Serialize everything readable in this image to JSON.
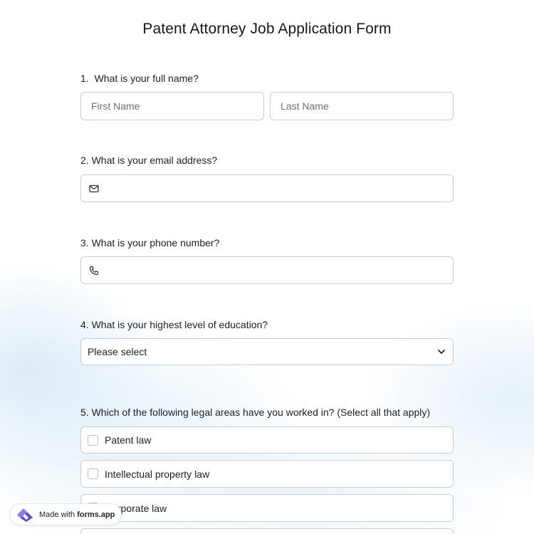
{
  "form": {
    "title": "Patent Attorney Job Application Form"
  },
  "questions": {
    "q1": {
      "number": "1.",
      "text": "What is your full name?",
      "first_placeholder": "First Name",
      "last_placeholder": "Last Name"
    },
    "q2": {
      "number": "2.",
      "text": "What is your email address?",
      "icon": "envelope-icon"
    },
    "q3": {
      "number": "3.",
      "text": "What is your phone number?",
      "icon": "phone-icon"
    },
    "q4": {
      "number": "4.",
      "text": "What is your highest level of education?",
      "select_value": "Please select",
      "icon": "chevron-down-icon"
    },
    "q5": {
      "number": "5.",
      "text": "Which of the following legal areas have you worked in? (Select all that apply)",
      "options": [
        "Patent law",
        "Intellectual property law",
        "Corporate law"
      ]
    }
  },
  "badge": {
    "prefix": "Made with ",
    "brand": "forms.app",
    "logo_colors": [
      "#5b4fe0",
      "#8a7ff0"
    ]
  },
  "colors": {
    "border": "#c9cdd3",
    "text": "#1c1f24",
    "placeholder": "#6c7178",
    "background_tint": "#dcebf6"
  }
}
